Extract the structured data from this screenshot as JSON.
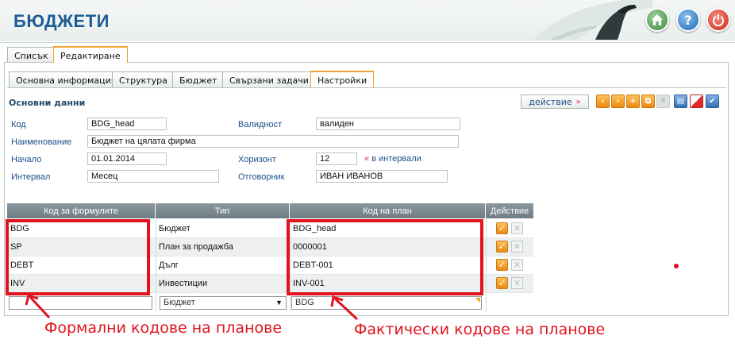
{
  "header": {
    "title": "БЮДЖЕТИ"
  },
  "top_tabs": [
    "Списък",
    "Редактиране"
  ],
  "sub_tabs": [
    "Основна информация",
    "Структура",
    "Бюджет",
    "Свързани задачи",
    "Настройки"
  ],
  "section": {
    "title": "Основни данни",
    "action_label": "действие"
  },
  "form": {
    "code_label": "Код",
    "code_value": "BDG_head",
    "validity_label": "Валидност",
    "validity_value": "валиден",
    "name_label": "Наименование",
    "name_value": "Бюджет на цялата фирма",
    "start_label": "Начало",
    "start_value": "01.01.2014",
    "horizon_label": "Хоризонт",
    "horizon_value": "12",
    "horizon_suffix": "в интервали",
    "interval_label": "Интервал",
    "interval_value": "Месец",
    "owner_label": "Отговорник",
    "owner_value": "ИВАН ИВАНОВ"
  },
  "grid": {
    "headers": [
      "Код за формулите",
      "Тип",
      "Код на план",
      "Действие"
    ],
    "rows": [
      {
        "formula_code": "BDG",
        "type": "Бюджет",
        "plan_code": "BDG_head"
      },
      {
        "formula_code": "SP",
        "type": "План за продажба",
        "plan_code": "0000001"
      },
      {
        "formula_code": "DEBT",
        "type": "Дълг",
        "plan_code": "DEBT-001"
      },
      {
        "formula_code": "INV",
        "type": "Инвестиции",
        "plan_code": "INV-001"
      }
    ],
    "new_row": {
      "formula_code": "",
      "type": "Бюджет",
      "plan_code": "BDG"
    }
  },
  "annotations": {
    "left": "Формални кодове на планове",
    "right": "Фактически кодове на планове"
  },
  "colors": {
    "brand_blue": "#1c5b97",
    "accent_orange": "#f0a030",
    "annotation_red": "#e0141f"
  }
}
